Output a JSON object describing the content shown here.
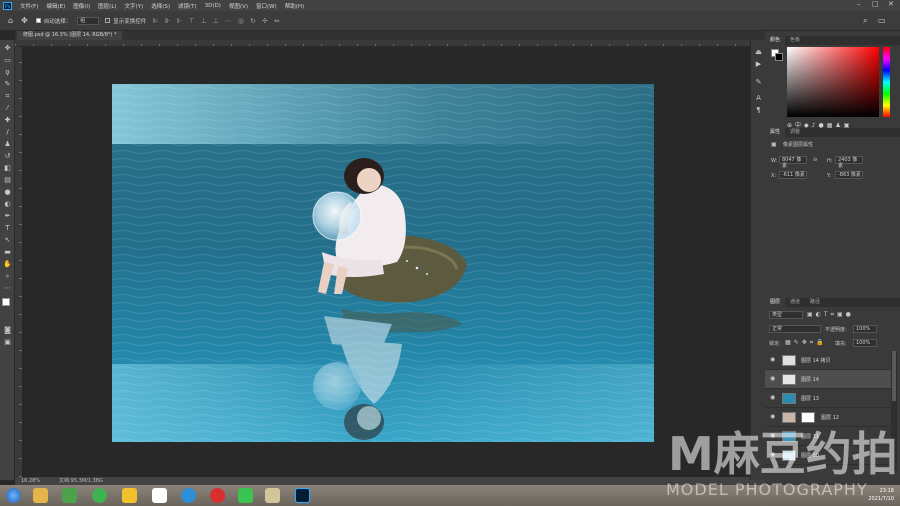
{
  "menu": [
    "文件(F)",
    "编辑(E)",
    "图像(I)",
    "图层(L)",
    "文字(Y)",
    "选择(S)",
    "滤镜(T)",
    "3D(D)",
    "视图(V)",
    "窗口(W)",
    "帮助(H)"
  ],
  "options": {
    "auto_select_label": "自动选择：",
    "auto_select_value": "组",
    "show_transform_label": "显示变换控件"
  },
  "document_tab": "修图.psd @ 16.3% (图层 14, RGB/8*) *",
  "status": {
    "zoom": "16.28%",
    "doc": "文档:95.3M/1.38G"
  },
  "color_panel": {
    "tabs": [
      "颜色",
      "色板"
    ]
  },
  "properties": {
    "tabs": [
      "属性",
      "调整"
    ],
    "title": "像素图层属性",
    "w_label": "W:",
    "w_value": "8047 像素",
    "h_label": "H:",
    "h_value": "2403 像素",
    "x_label": "X:",
    "x_value": "-611 像素",
    "y_label": "Y:",
    "y_value": "-863 像素"
  },
  "layers_panel": {
    "tabs": [
      "图层",
      "通道",
      "路径"
    ],
    "filter_kind": "类型",
    "blend_mode": "正常",
    "opacity_label": "不透明度:",
    "opacity_value": "100%",
    "lock_label": "锁定:",
    "fill_label": "填充:",
    "fill_value": "100%",
    "layers": [
      {
        "name": "图层 14 拷贝",
        "selected": false
      },
      {
        "name": "图层 14",
        "selected": true
      },
      {
        "name": "图层 13",
        "selected": false
      },
      {
        "name": "图层 12",
        "selected": false
      },
      {
        "name": "图层 11",
        "selected": false
      },
      {
        "name": "图层 10",
        "selected": false
      }
    ]
  },
  "watermark": {
    "brand_cn": "M麻豆约拍",
    "brand_en": "MODEL PHOTOGRAPHY"
  },
  "clock": {
    "time": "23:18",
    "date": "2021/7/10"
  },
  "colors": {
    "menubar": "#424242",
    "panel": "#3a3a3a",
    "canvas_bg": "#282828",
    "water": "#1f7fa0",
    "accent_ps": "#31a8ff"
  }
}
